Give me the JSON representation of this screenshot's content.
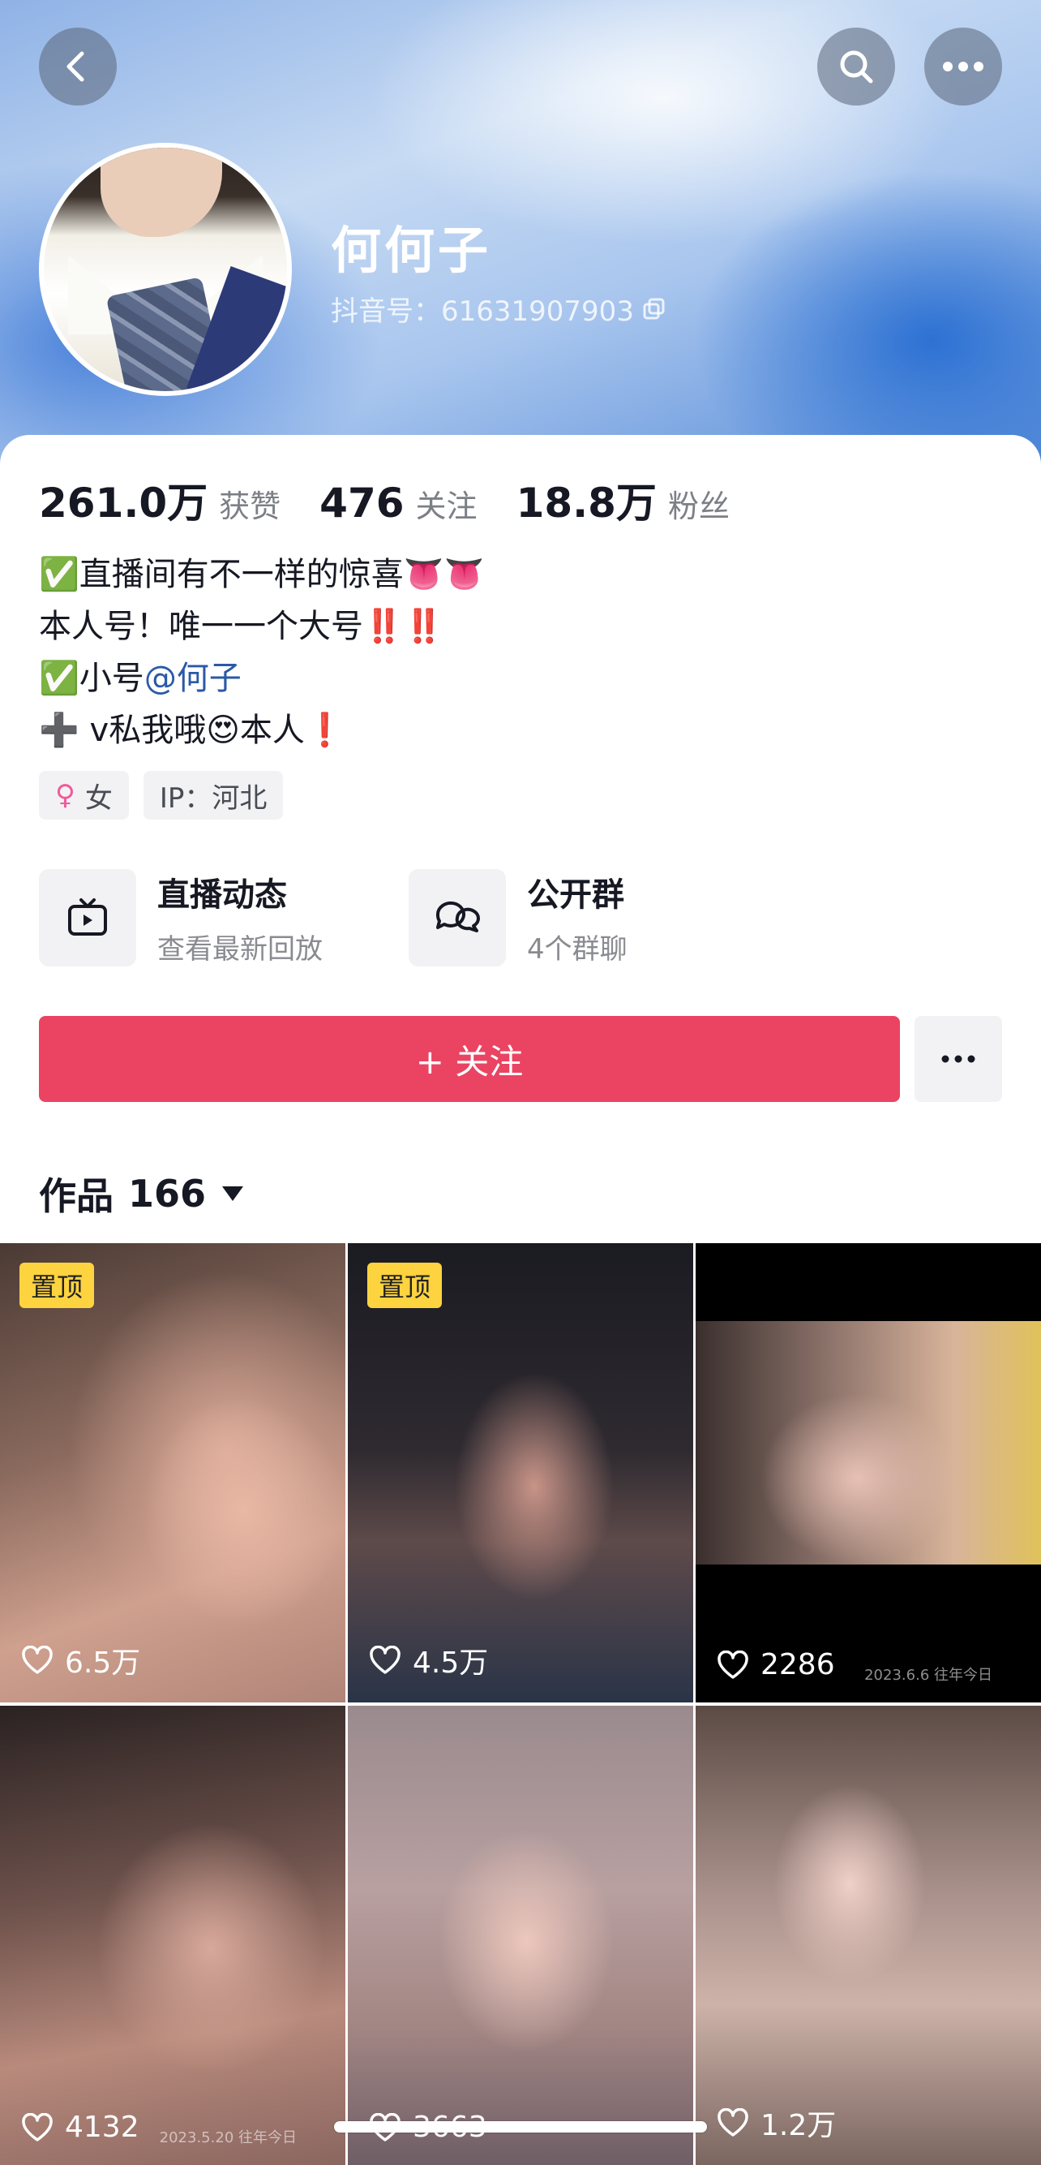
{
  "header": {
    "back_icon": "chevron-left-icon",
    "search_icon": "search-icon",
    "more_icon": "more-horizontal-icon"
  },
  "profile": {
    "name": "何何子",
    "douyin_id": "抖音号：61631907903",
    "copy_icon": "copy-icon"
  },
  "stats": [
    {
      "value": "261.0万",
      "label": "获赞"
    },
    {
      "value": "476",
      "label": "关注"
    },
    {
      "value": "18.8万",
      "label": "粉丝"
    }
  ],
  "bio": {
    "line1": "✅直播间有不一样的惊喜👅👅",
    "line2": "本人号！唯一一个大号‼️‼️",
    "line3_prefix": "✅小号",
    "line3_mention": "@何子",
    "line4": "➕ v私我哦😍本人❗"
  },
  "tags": {
    "gender": "女",
    "gender_icon": "female-icon",
    "ip": "IP：河北"
  },
  "entries": {
    "live": {
      "title": "直播动态",
      "subtitle": "查看最新回放",
      "icon": "tv-icon"
    },
    "group": {
      "title": "公开群",
      "subtitle": "4个群聊",
      "icon": "chat-bubbles-icon"
    }
  },
  "actions": {
    "follow_label": "+ 关注",
    "more_icon": "more-horizontal-icon"
  },
  "works": {
    "label": "作品",
    "count": "166",
    "items": [
      {
        "pinned": "置顶",
        "likes": "6.5万",
        "stamp": ""
      },
      {
        "pinned": "置顶",
        "likes": "4.5万",
        "stamp": ""
      },
      {
        "pinned": "",
        "likes": "2286",
        "stamp": "2023.6.6 往年今日"
      },
      {
        "pinned": "",
        "likes": "4132",
        "stamp": "2023.5.20 往年今日"
      },
      {
        "pinned": "",
        "likes": "3663",
        "stamp": ""
      },
      {
        "pinned": "",
        "likes": "1.2万",
        "stamp": ""
      }
    ]
  },
  "colors": {
    "accent": "#ea4462",
    "pin": "#fdd33f",
    "mention": "#2a5aa6"
  }
}
